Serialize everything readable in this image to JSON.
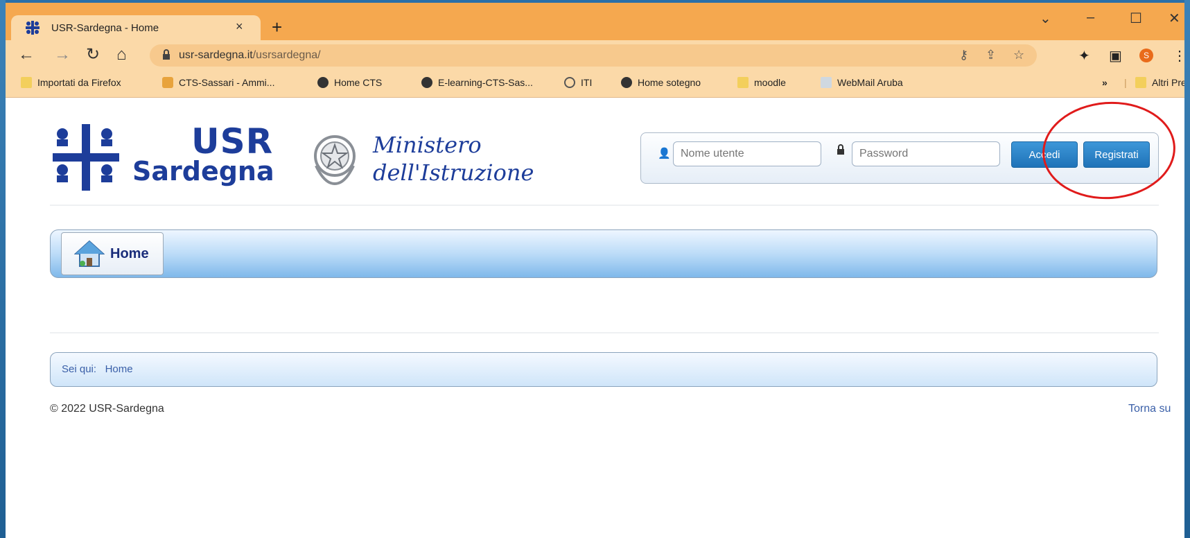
{
  "browser": {
    "tab_title": "USR-Sardegna - Home",
    "tab_close": "×",
    "new_tab": "+",
    "url_host": "usr-sardegna.it",
    "url_path": "/usrsardegna/",
    "window_controls": [
      "⌄",
      "–",
      "☐",
      "✕"
    ],
    "profile_initial": "S",
    "bookmarks": [
      {
        "label": "Importati da Firefox",
        "icon": "folder-icon"
      },
      {
        "label": "CTS-Sassari - Ammi...",
        "icon": "joomla-icon"
      },
      {
        "label": "Home CTS",
        "icon": "globe-icon"
      },
      {
        "label": "E-learning-CTS-Sas...",
        "icon": "globe-icon"
      },
      {
        "label": "ITI",
        "icon": "iti-icon"
      },
      {
        "label": "Home sotegno",
        "icon": "globe-icon"
      },
      {
        "label": "moodle",
        "icon": "folder-icon"
      },
      {
        "label": "WebMail Aruba",
        "icon": "webmail-icon"
      }
    ],
    "bookmarks_more": "»",
    "other_bookmarks": "Altri Preferiti"
  },
  "site": {
    "logo_usr": "USR",
    "logo_sardegna": "Sardegna",
    "ministero_line1": "Ministero",
    "ministero_line2": "dell'Istruzione",
    "username_placeholder": "Nome utente",
    "password_placeholder": "Password",
    "login_button": "Accedi",
    "register_button": "Registrati",
    "nav_home": "Home",
    "breadcrumb_prefix": "Sei qui:",
    "breadcrumb_current": "Home",
    "footer_copyright": "© 2022 USR-Sardegna",
    "footer_back_to_top": "Torna su"
  },
  "colors": {
    "browser_frame": "#f5a84f",
    "toolbar": "#fbd9a8",
    "brand_blue": "#1d3d9a",
    "button_blue": "#2a85c9",
    "annotation_red": "#e01b1b"
  }
}
